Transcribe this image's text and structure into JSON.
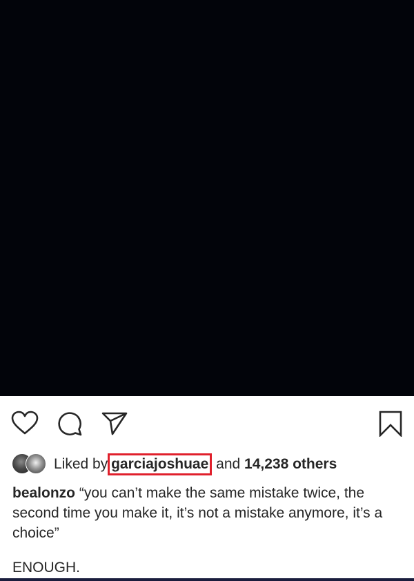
{
  "post": {
    "image_color": "#02040a"
  },
  "actions": {
    "like_icon": "heart-icon",
    "comment_icon": "comment-icon",
    "share_icon": "paper-plane-icon",
    "save_icon": "bookmark-icon"
  },
  "likes": {
    "prefix": "Liked by",
    "username": "garciajoshuae",
    "connector": "and",
    "count_text": "14,238 others",
    "highlight_color": "#e0202c"
  },
  "caption": {
    "username": "bealonzo",
    "text": "“you can’t make the same mistake twice, the second time you make it, it’s not a mistake anymore, it’s a choice”",
    "footer": "ENOUGH."
  }
}
